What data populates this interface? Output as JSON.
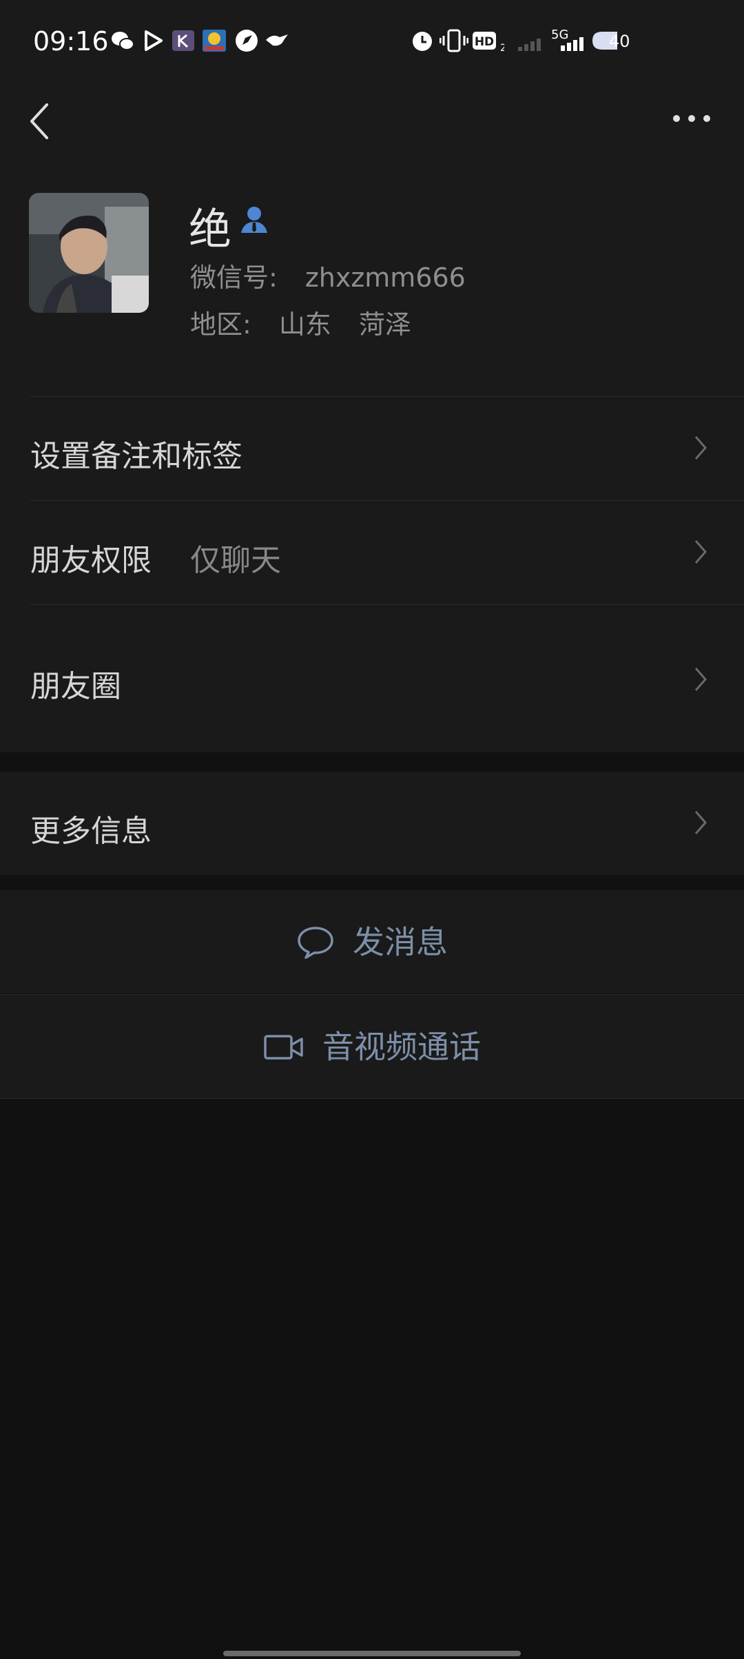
{
  "status_bar": {
    "time": "09:16",
    "network": "5G",
    "battery": "40",
    "icons": [
      "wechat-icon",
      "play-icon",
      "k-app-icon",
      "game-app-icon",
      "compass-icon",
      "bird-icon",
      "alarm-icon",
      "vibrate-icon",
      "hd-icon",
      "signal-icon",
      "battery-icon"
    ]
  },
  "nav": {
    "back_icon": "back-chevron-icon",
    "more_icon": "more-dots-icon"
  },
  "profile": {
    "name": "绝",
    "wechat_id_label": "微信号:",
    "wechat_id": "zhxzmm666",
    "region_label": "地区:",
    "region_province": "山东",
    "region_city": "菏泽"
  },
  "rows": [
    {
      "label": "设置备注和标签"
    },
    {
      "label": "朋友权限",
      "value": "仅聊天"
    },
    {
      "label": "朋友圈"
    },
    {
      "label": "更多信息"
    }
  ],
  "actions": {
    "send_message": "发消息",
    "av_call": "音视频通话"
  },
  "colors": {
    "background": "#111111",
    "panel": "#1a1a1a",
    "action_text": "#7c8fa8",
    "badge": "#4e86d3"
  }
}
